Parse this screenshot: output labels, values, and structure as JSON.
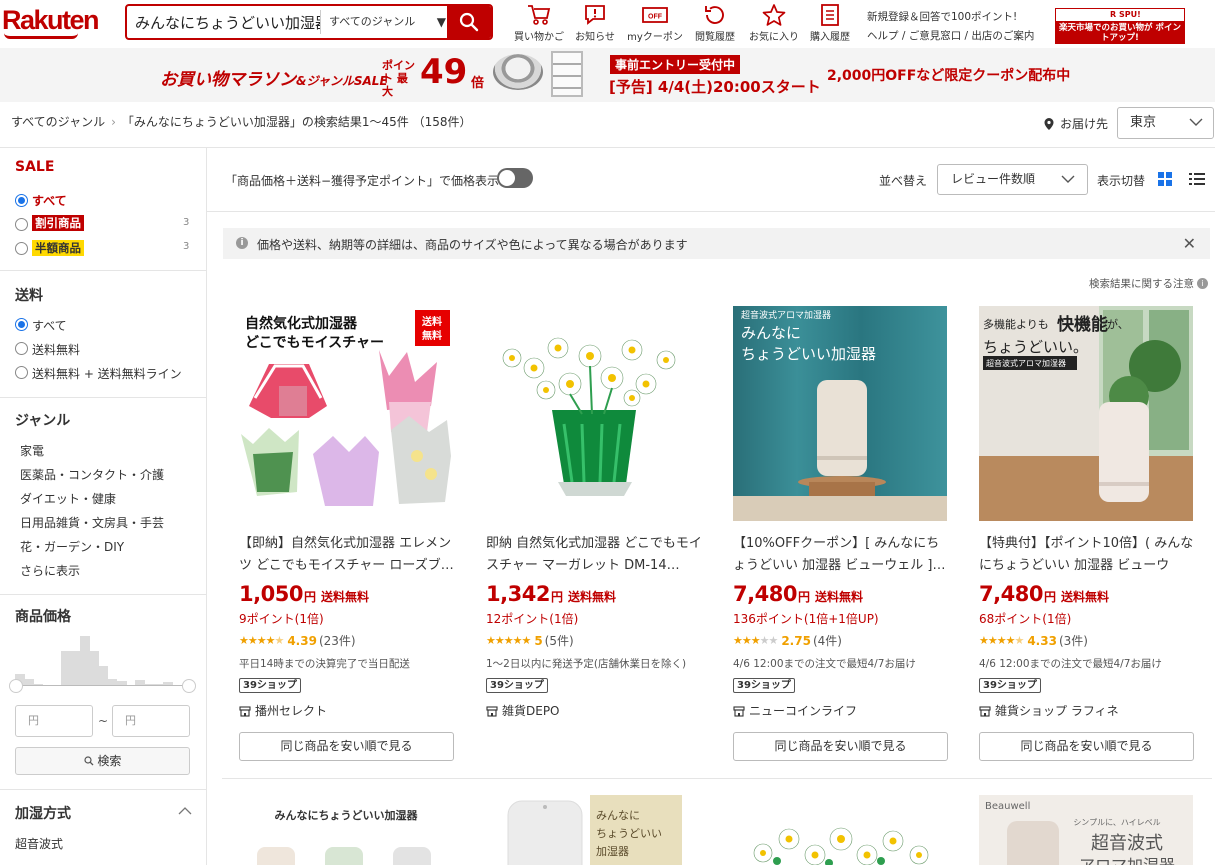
{
  "header": {
    "logo": "Rakuten",
    "search_value": "みんなにちょうどいい加湿器",
    "genre_select": "すべてのジャンル",
    "nav": [
      {
        "label": "買い物かご",
        "icon": "cart-icon"
      },
      {
        "label": "お知らせ",
        "icon": "notification-icon"
      },
      {
        "label": "myクーポン",
        "icon": "coupon-icon"
      },
      {
        "label": "閲覧履歴",
        "icon": "history-icon"
      },
      {
        "label": "お気に入り",
        "icon": "star-icon"
      },
      {
        "label": "購入履歴",
        "icon": "receipt-icon"
      }
    ],
    "signup_promo": "新規登録＆回答で100ポイント!",
    "help_links": "ヘルプ / ご意見窓口 / 出店のご案内",
    "spu_label": "R SPU!",
    "spu_message": "楽天市場でのお買い物が ポイントアップ!"
  },
  "campaign": {
    "title": "お買い物マラソン",
    "title_suffix": "&ジャンルSALE",
    "point_label": "ポイント 最大",
    "multiplier": "49",
    "multiplier_unit": "倍",
    "entry_badge": "事前エントリー受付中",
    "start_date": "[予告] 4/4(土)20:00スタート",
    "coupon_text": "2,000円OFFなど限定クーポン配布中"
  },
  "breadcrumb": {
    "root": "すべてのジャンル",
    "result": "「みんなにちょうどいい加湿器」の検索結果1～45件 （158件）"
  },
  "delivery": {
    "label": "お届け先",
    "prefecture": "東京"
  },
  "sidebar": {
    "sale": {
      "heading": "SALE",
      "options": [
        {
          "label": "すべて",
          "selected": true
        },
        {
          "label": "割引商品",
          "count": "3"
        },
        {
          "label": "半額商品",
          "count": "3"
        }
      ]
    },
    "shipping": {
      "heading": "送料",
      "options": [
        {
          "label": "すべて",
          "selected": true
        },
        {
          "label": "送料無料"
        },
        {
          "label": "送料無料 + 送料無料ライン"
        }
      ]
    },
    "genre": {
      "heading": "ジャンル",
      "items": [
        "家電",
        "医薬品・コンタクト・介護",
        "ダイエット・健康",
        "日用品雑貨・文房具・手芸",
        "花・ガーデン・DIY",
        "さらに表示"
      ]
    },
    "price": {
      "heading": "商品価格",
      "min_placeholder": "円",
      "max_placeholder": "円",
      "separator": "~",
      "search_label": "検索",
      "histogram": [
        10,
        6,
        2,
        1,
        1,
        28,
        28,
        40,
        28,
        16,
        6,
        4,
        1,
        5,
        2,
        2,
        3,
        1,
        1
      ]
    },
    "humidify": {
      "heading": "加湿方式",
      "items": [
        "超音波式"
      ]
    }
  },
  "toolbar": {
    "price_toggle_label": "「商品価格＋送料−獲得予定ポイント」で価格表示",
    "sort_label": "並べ替え",
    "sort_value": "レビュー件数順",
    "view_label": "表示切替"
  },
  "notice": {
    "text": "価格や送料、納期等の詳細は、商品のサイズや色によって異なる場合があります",
    "caution_link": "検索結果に関する注意"
  },
  "products": [
    {
      "title": "【即納】自然気化式加湿器 エレメンツ どこでもモイスチャー ローズブ…",
      "price": "1,050",
      "yen": "円",
      "shipping": "送料無料",
      "points": "9ポイント(1倍)",
      "rating": 4.39,
      "rating_text": "4.39",
      "reviews": "(23件)",
      "ship_note": "平日14時までの決算完了で当日配送",
      "badge": "39ショップ",
      "shop": "播州セレクト",
      "image_text": [
        "自然気化式加湿器",
        "どこでもモイスチャー",
        "送料",
        "無料"
      ],
      "cheaper_label": "同じ商品を安い順で見る"
    },
    {
      "title": "即納 自然気化式加湿器 どこでもモイスチャー マーガレット DM-14…",
      "price": "1,342",
      "yen": "円",
      "shipping": "送料無料",
      "points": "12ポイント(1倍)",
      "rating": 5,
      "rating_text": "5",
      "reviews": "(5件)",
      "ship_note": "1〜2日以内に発送予定(店舗休業日を除く)",
      "badge": "39ショップ",
      "shop": "雑貨DEPO",
      "image_text": [],
      "cheaper_label": ""
    },
    {
      "title": "【10%OFFクーポン】[ みんなにちょうどいい 加湿器 ビューウェル ]…",
      "price": "7,480",
      "yen": "円",
      "shipping": "送料無料",
      "points": "136ポイント(1倍+1倍UP)",
      "rating": 2.75,
      "rating_text": "2.75",
      "reviews": "(4件)",
      "ship_note": "4/6 12:00までの注文で最短4/7お届け",
      "badge": "39ショップ",
      "shop": "ニューコインライフ",
      "image_text": [
        "超音波式アロマ加湿器",
        "みんなに",
        "ちょうどいい加湿器"
      ],
      "cheaper_label": "同じ商品を安い順で見る"
    },
    {
      "title": "【特典付】【ポイント10倍】( みんなにちょうどいい 加湿器 ビューウェ…",
      "price": "7,480",
      "yen": "円",
      "shipping": "送料無料",
      "points": "68ポイント(1倍)",
      "rating": 4.33,
      "rating_text": "4.33",
      "reviews": "(3件)",
      "ship_note": "4/6 12:00までの注文で最短4/7お届け",
      "badge": "39ショップ",
      "shop": "雑貨ショップ ラフィネ",
      "image_text": [
        "多機能よりも",
        "快機能",
        "が、",
        "ちょうどいい。",
        "超音波式アロマ加湿器"
      ],
      "cheaper_label": "同じ商品を安い順で見る"
    }
  ],
  "products_row2": [
    {
      "image_text": [
        "みんなにちょうどいい加湿器"
      ]
    },
    {
      "image_text": [
        "みんなに",
        "ちょうどいい",
        "加湿器"
      ]
    },
    {
      "image_text": []
    },
    {
      "image_text": [
        "Beauwell",
        "シンプルに、ハイレベル",
        "超音波式",
        "アロマ加湿器"
      ]
    }
  ],
  "colors": {
    "brand": "#bf0000",
    "rating": "#f0a000",
    "link_blue": "#1a73e8"
  }
}
